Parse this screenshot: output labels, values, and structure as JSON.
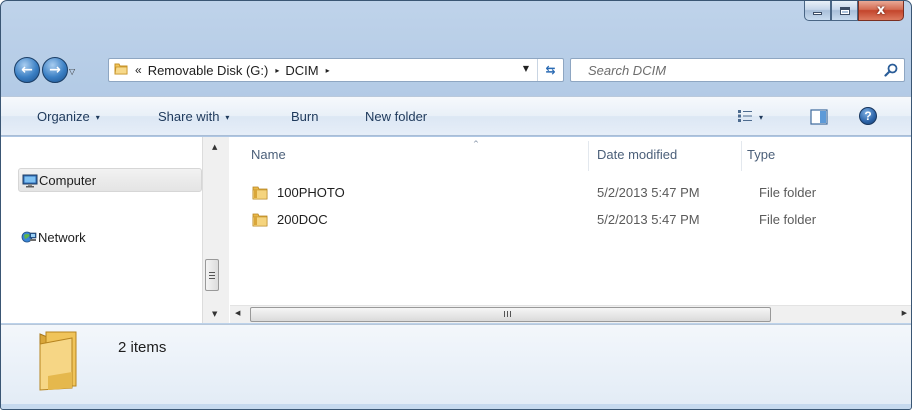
{
  "window": {
    "caption_buttons": {
      "minimize_icon": "minimize-icon",
      "maximize_icon": "maximize-icon",
      "close_icon": "close-icon",
      "close_glyph": "x"
    }
  },
  "navigation": {
    "back_icon": "back-arrow-icon",
    "forward_icon": "forward-arrow-icon",
    "recent_icon": "chevron-down-icon",
    "address": {
      "overflow": "«",
      "crumbs": [
        "Removable Disk (G:)",
        "DCIM"
      ],
      "separator": "▸"
    },
    "refresh_icon": "refresh-icon",
    "search": {
      "placeholder": "Search DCIM",
      "icon": "search-icon"
    }
  },
  "command_bar": {
    "organize_label": "Organize",
    "share_label": "Share with",
    "burn_label": "Burn",
    "new_folder_label": "New folder",
    "caret": "▾",
    "view_icon": "details-view-icon",
    "preview_icon": "preview-pane-icon",
    "help_icon": "help-icon",
    "help_glyph": "?"
  },
  "nav_pane": {
    "items": [
      {
        "label": "Computer",
        "icon": "computer-icon",
        "selected": true
      },
      {
        "label": "Network",
        "icon": "network-icon",
        "selected": false
      }
    ]
  },
  "file_list": {
    "columns": [
      "Name",
      "Date modified",
      "Type"
    ],
    "sort_indicator": "^",
    "rows": [
      {
        "name": "100PHOTO",
        "date": "5/2/2013 5:47 PM",
        "type": "File folder",
        "icon": "folder-icon"
      },
      {
        "name": "200DOC",
        "date": "5/2/2013 5:47 PM",
        "type": "File folder",
        "icon": "folder-icon"
      }
    ]
  },
  "scrollbars": {
    "up": "▲",
    "down": "▼",
    "left": "◀",
    "right": "▶"
  },
  "details": {
    "count_text": "2 items",
    "icon": "folder-icon"
  },
  "colors": {
    "frame": "#aac4e2",
    "close_button": "#c3442b",
    "command_text": "#1e395b",
    "folder": "#e8b84a"
  }
}
